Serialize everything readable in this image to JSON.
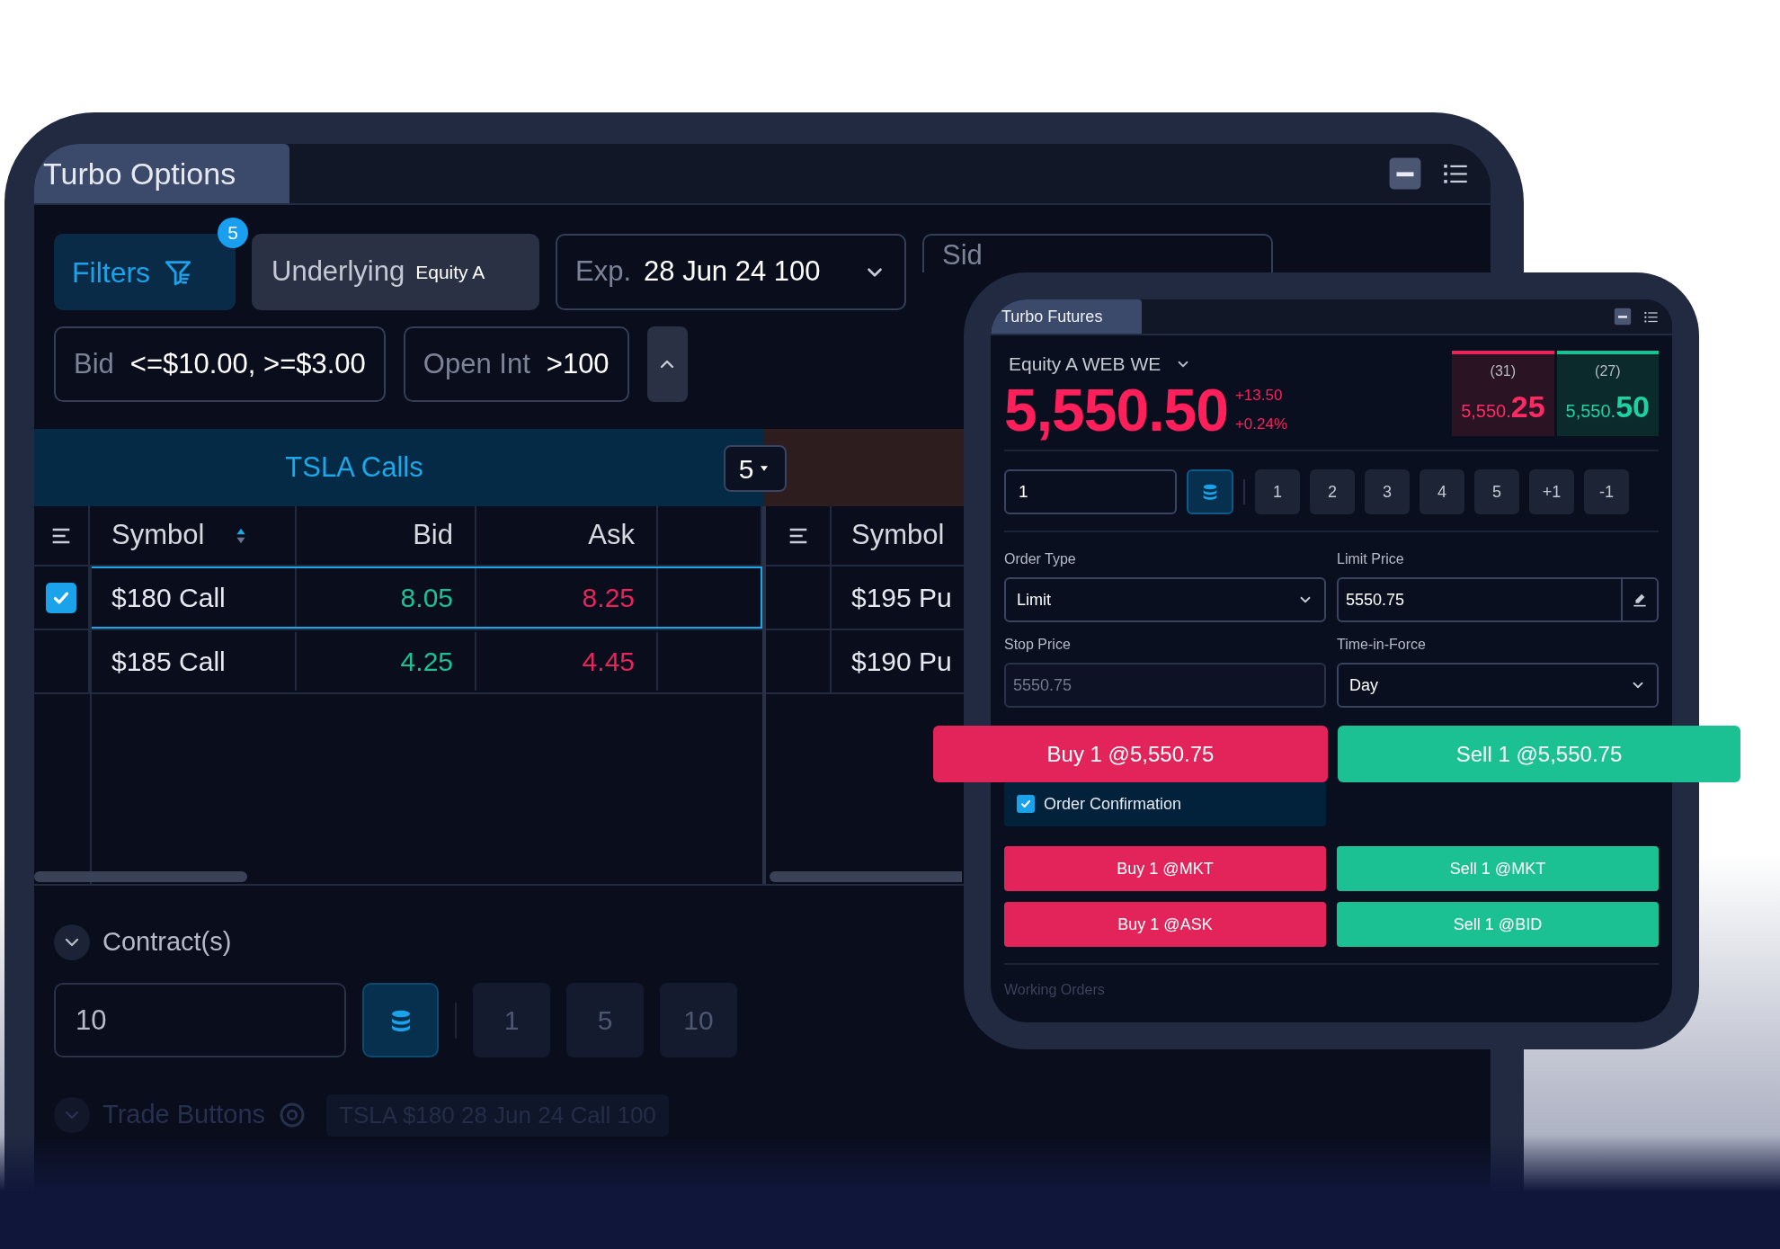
{
  "options_window": {
    "title": "Turbo Options",
    "filters": [
      {
        "kind": "filters",
        "label": "Filters",
        "badge": "5"
      },
      {
        "kind": "filled",
        "label": "Underlying",
        "value": "Equity A"
      },
      {
        "kind": "dropdown",
        "label": "Exp.",
        "value": "28 Jun 24 100"
      },
      {
        "kind": "dropdown",
        "label": "Sid"
      }
    ],
    "criteria": [
      {
        "label": "Bid",
        "value": "<=$10.00, >=$3.00"
      },
      {
        "label": "Open Int",
        "value": ">100"
      }
    ],
    "calls_table": {
      "title": "TSLA Calls",
      "count": "5",
      "columns": [
        {
          "label": "Symbol",
          "sorted": true
        },
        {
          "label": "Bid",
          "sorted": false
        },
        {
          "label": "Ask",
          "sorted": false
        }
      ],
      "rows": [
        {
          "symbol": "$180 Call",
          "bid": "8.05",
          "ask": "8.25",
          "selected": true
        },
        {
          "symbol": "$185 Call",
          "bid": "4.25",
          "ask": "4.45",
          "selected": false
        }
      ]
    },
    "puts_table": {
      "columns": [
        "Symbol"
      ],
      "rows": [
        {
          "symbol": "$195 Pu"
        },
        {
          "symbol": "$190 Pu"
        }
      ]
    },
    "contracts": {
      "label": "Contract(s)",
      "quantity": "10",
      "presets": [
        "1",
        "5",
        "10"
      ]
    },
    "trade_buttons": {
      "label": "Trade Buttons",
      "contract": "TSLA $180 28 Jun 24 Call 100"
    }
  },
  "futures_window": {
    "title": "Turbo Futures",
    "instrument": "Equity A WEB WE",
    "last_price": "5,550.50",
    "change": "+13.50",
    "change_percent": "+0.24%",
    "quotes": [
      {
        "kind": "bid",
        "size": "(31)",
        "price_main": "5,550.",
        "price_tick": "25"
      },
      {
        "kind": "ask",
        "size": "(27)",
        "price_main": "5,550.",
        "price_tick": "50"
      }
    ],
    "quantity": "1",
    "presets": [
      "1",
      "2",
      "3",
      "4",
      "5",
      "+1",
      "-1"
    ],
    "order_type": {
      "label": "Order Type",
      "value": "Limit"
    },
    "limit_price": {
      "label": "Limit Price",
      "value": "5550.75"
    },
    "stop_price": {
      "label": "Stop Price",
      "placeholder": "5550.75"
    },
    "time_in_force": {
      "label": "Time-in-Force",
      "value": "Day"
    },
    "limit_buttons": [
      {
        "kind": "buy",
        "label": "Buy 1 @5,550.75"
      },
      {
        "kind": "sell",
        "label": "Sell 1 @5,550.75"
      }
    ],
    "order_confirmation": {
      "label": "Order Confirmation",
      "checked": true
    },
    "quick_buttons": [
      {
        "kind": "buy",
        "label": "Buy 1 @MKT"
      },
      {
        "kind": "sell",
        "label": "Sell 1 @MKT"
      },
      {
        "kind": "buy",
        "label": "Buy 1 @ASK"
      },
      {
        "kind": "sell",
        "label": "Sell 1 @BID"
      }
    ],
    "working_orders": "Working Orders"
  }
}
